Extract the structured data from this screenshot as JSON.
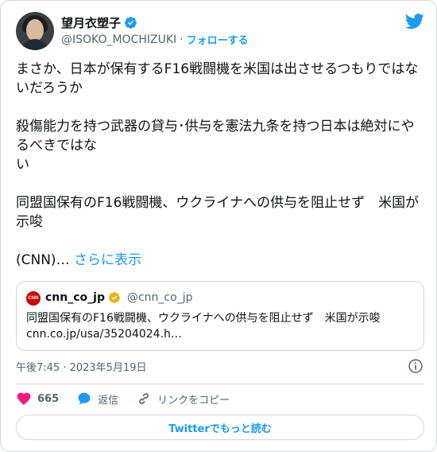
{
  "author": {
    "display_name": "望月衣塑子",
    "handle": "@ISOKO_MOCHIZUKI",
    "separator": "·",
    "follow_label": "フォローする"
  },
  "tweet": {
    "text": "まさか、日本が保有するF16戦闘機を米国は出させるつもりではないだろうか\n\n殺傷能力を持つ武器の貸与･供与を憲法九条を持つ日本は絶対にやるべきではな\nい\n\n同盟国保有のF16戦闘機、ウクライナへの供与を阻止せず　米国が示唆\n\n(CNN)… ",
    "show_more_label": "さらに表示"
  },
  "quote": {
    "logo_text": "CNN",
    "name": "cnn_co_jp",
    "handle": "@cnn_co_jp",
    "text": "同盟国保有のF16戦闘機、ウクライナへの供与を阻止せず　米国が示唆\ncnn.co.jp/usa/35204024.h…"
  },
  "meta": {
    "timestamp": "午後7:45 · 2023年5月19日"
  },
  "actions": {
    "likes_count": "665",
    "reply_label": "返信",
    "copy_link_label": "リンクをコピー"
  },
  "read_more_label": "Twitterでもっと読む",
  "colors": {
    "accent": "#1d9bf0",
    "like": "#f91880",
    "text": "#0f1419",
    "muted": "#536471",
    "border": "#cfd9de",
    "gold_badge": "#e2b719"
  },
  "icons": [
    "verified-badge-icon",
    "twitter-bird-icon",
    "info-icon",
    "heart-icon",
    "reply-bubble-icon",
    "link-icon",
    "gold-verified-badge-icon"
  ]
}
